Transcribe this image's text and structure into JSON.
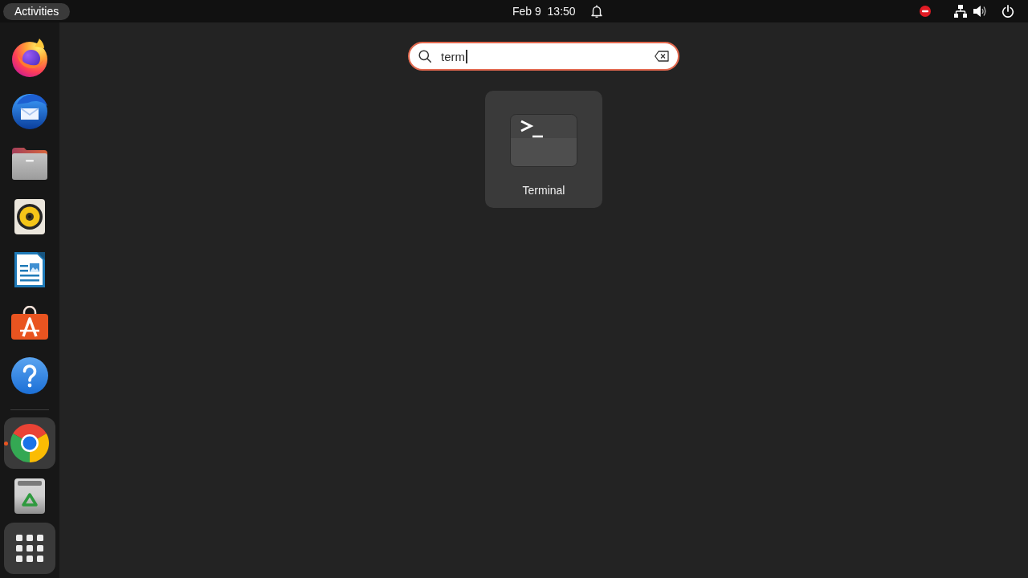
{
  "top_bar": {
    "activities": {
      "label": "Activities"
    },
    "clock": {
      "label": "Feb 9  13:50"
    }
  },
  "dock": {
    "groups": [
      {
        "apps": [
          {
            "kind": "fox",
            "running": false,
            "focused": false
          },
          {
            "kind": "bird",
            "running": false,
            "focused": false
          },
          {
            "kind": "folder",
            "running": false,
            "focused": false
          },
          {
            "kind": "speaker",
            "running": false,
            "focused": false
          },
          {
            "kind": "document",
            "running": false,
            "focused": false
          },
          {
            "kind": "bag",
            "running": false,
            "focused": false
          },
          {
            "kind": "help",
            "running": false,
            "focused": false
          }
        ]
      },
      {
        "apps": [
          {
            "kind": "wheel",
            "running": true,
            "focused": true
          },
          {
            "kind": "trash",
            "running": false,
            "focused": false
          }
        ]
      }
    ],
    "show_apps": {
      "checked": true
    }
  },
  "search": {
    "value": "term"
  },
  "results": [
    {
      "label": "Terminal",
      "selected": true
    }
  ]
}
